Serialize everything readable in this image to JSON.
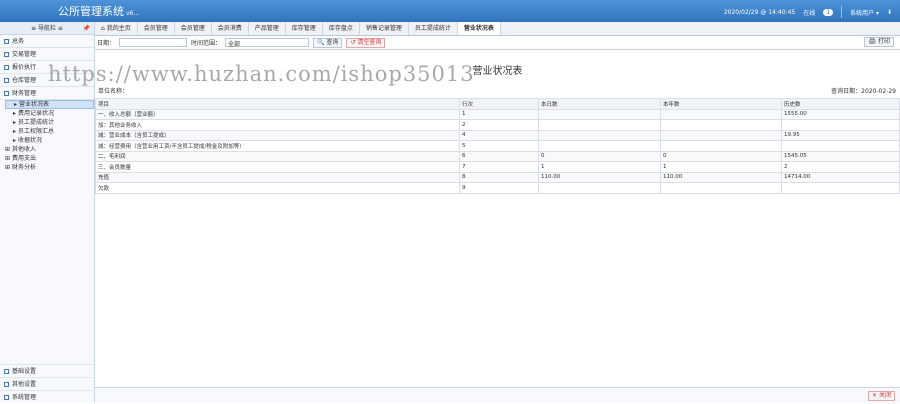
{
  "app": {
    "title": "公所管理系统",
    "version": "v6...",
    "datetime": "2020/02/29 @ 14:40:45",
    "online_label": "在线",
    "online_count": "1",
    "user": "系统用户 ▾",
    "logout": "⬇"
  },
  "sidebar": {
    "title": "≡ 导航栏 ≡",
    "top_items": [
      "总务",
      "交易管理",
      "报价执行",
      "仓库管理",
      "财务管理"
    ],
    "tree": [
      "营业状况表",
      "费用记录状况",
      "员工提成统计",
      "员工权限汇总",
      "收据状况",
      "其他收入",
      "费用支出",
      "财务分析"
    ],
    "bottom_items": [
      "基础设置",
      "其他设置",
      "系统管理"
    ]
  },
  "tabs": [
    "我的主页",
    "会员管理",
    "会员管理",
    "会员消费",
    "产品管理",
    "库存管理",
    "库存盘点",
    "销售记录管理",
    "员工提成统计",
    "营业状况表"
  ],
  "toolbar": {
    "date_label": "日期：",
    "date_value": "",
    "range_label": "时间范围：",
    "range_value": "全部",
    "search": "查询",
    "reset": "清空查询",
    "print": "打印"
  },
  "report": {
    "title": "营业状况表",
    "shop": "单位名称：",
    "query_date": "查询日期：2020-02-29",
    "headers": [
      "项目",
      "行次",
      "本日数",
      "本年数",
      "历史数"
    ],
    "rows": [
      [
        "一、收入总额（营业额）",
        "1",
        "",
        "",
        "1555.00"
      ],
      [
        "  加：其他业务收入",
        "2",
        "",
        "",
        ""
      ],
      [
        "  减：营业成本（含员工提成）",
        "4",
        "",
        "",
        "19.95"
      ],
      [
        "  减：经营费用（含营业用工资/不含员工提成/税金及附加等）",
        "5",
        "",
        "",
        ""
      ],
      [
        "二、毛利润",
        "6",
        "0",
        "0",
        "1545.05"
      ],
      [
        "三、会员数量",
        "7",
        "1",
        "1",
        "2"
      ],
      [
        "  充值",
        "8",
        "110.00",
        "110.00",
        "14714.00"
      ],
      [
        "  欠款",
        "9",
        "",
        "",
        ""
      ]
    ]
  },
  "footer": {
    "close": "关闭"
  },
  "watermark": "https://www.huzhan.com/ishop35013"
}
